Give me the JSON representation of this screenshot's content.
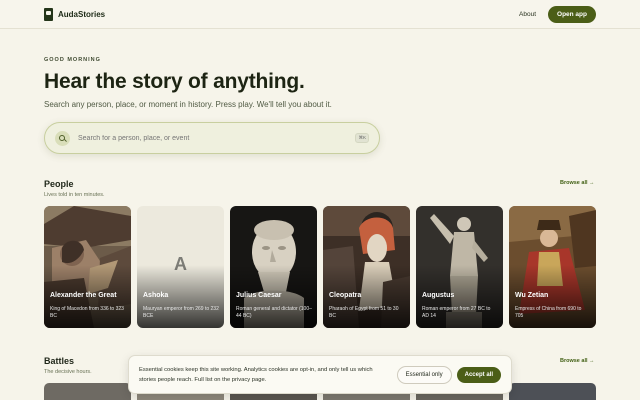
{
  "header": {
    "app_name": "AudaStories",
    "about_label": "About",
    "open_app_label": "Open app"
  },
  "hero": {
    "kicker": "GOOD MORNING",
    "title": "Hear the story of anything.",
    "subtitle": "Search any person, place, or moment in history. Press play. We'll tell you about it."
  },
  "search": {
    "placeholder": "Search for a person, place, or event",
    "shortcut": "⌘K"
  },
  "people": {
    "title": "People",
    "subtitle": "Lives told in ten minutes.",
    "browse_label": "Browse all →",
    "cards": [
      {
        "name": "Alexander the Great",
        "desc": "King of Macedon from 336 to 323 BC"
      },
      {
        "name": "Ashoka",
        "desc": "Mauryan emperor from 269 to 232 BCE",
        "placeholder_letter": "A"
      },
      {
        "name": "Julius Caesar",
        "desc": "Roman general and dictator (100–44 BC)"
      },
      {
        "name": "Cleopatra",
        "desc": "Pharaoh of Egypt from 51 to 30 BC"
      },
      {
        "name": "Augustus",
        "desc": "Roman emperor from 27 BC to AD 14"
      },
      {
        "name": "Wu Zetian",
        "desc": "Empress of China from 690 to 705"
      }
    ]
  },
  "battles": {
    "title": "Battles",
    "subtitle": "The decisive hours.",
    "browse_label": "Browse all →"
  },
  "cookie_banner": {
    "text": "Essential cookies keep this site working. Analytics cookies are opt-in, and only tell us which stories people reach. Full list on the privacy page.",
    "essential_label": "Essential only",
    "accept_label": "Accept all"
  },
  "colors": {
    "background": "#f6f4ea",
    "accent": "#4b5e17",
    "text": "#1f2619"
  }
}
